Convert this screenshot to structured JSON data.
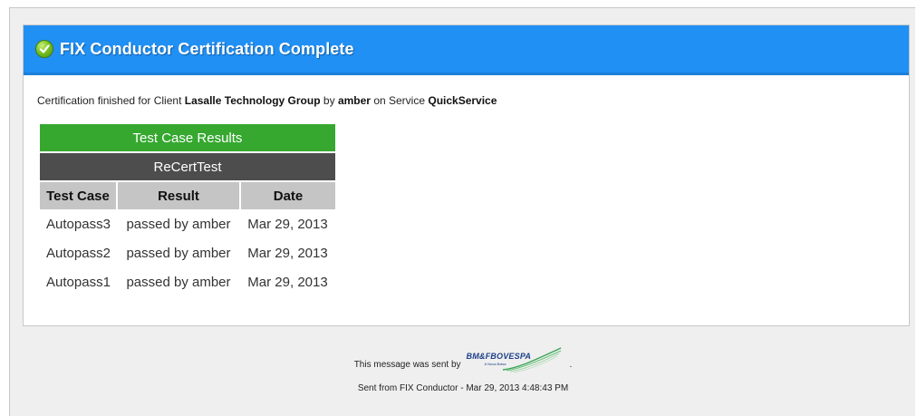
{
  "banner": {
    "title": "FIX Conductor Certification Complete",
    "icon": "green-check-icon",
    "color": "#2190f4"
  },
  "summary": {
    "prefix": "Certification finished for Client",
    "client": "Lasalle Technology Group",
    "by": "by",
    "user": "amber",
    "on_service": "on Service",
    "service": "QuickService"
  },
  "results": {
    "title": "Test Case Results",
    "suite": "ReCertTest",
    "columns": [
      "Test Case",
      "Result",
      "Date"
    ],
    "rows": [
      {
        "test_case": "Autopass3",
        "result": "passed by amber",
        "date": "Mar 29, 2013"
      },
      {
        "test_case": "Autopass2",
        "result": "passed by amber",
        "date": "Mar 29, 2013"
      },
      {
        "test_case": "Autopass1",
        "result": "passed by amber",
        "date": "Mar 29, 2013"
      }
    ],
    "title_color": "#36a830",
    "suite_color": "#4d4d4d"
  },
  "footer": {
    "sent_by": "This message was sent by",
    "logo_text": "BM&FBOVESPA",
    "logo_subtext": "A Nova Bolsa",
    "period": ".",
    "sent_from": "Sent from FIX Conductor - Mar 29, 2013 4:48:43 PM"
  }
}
